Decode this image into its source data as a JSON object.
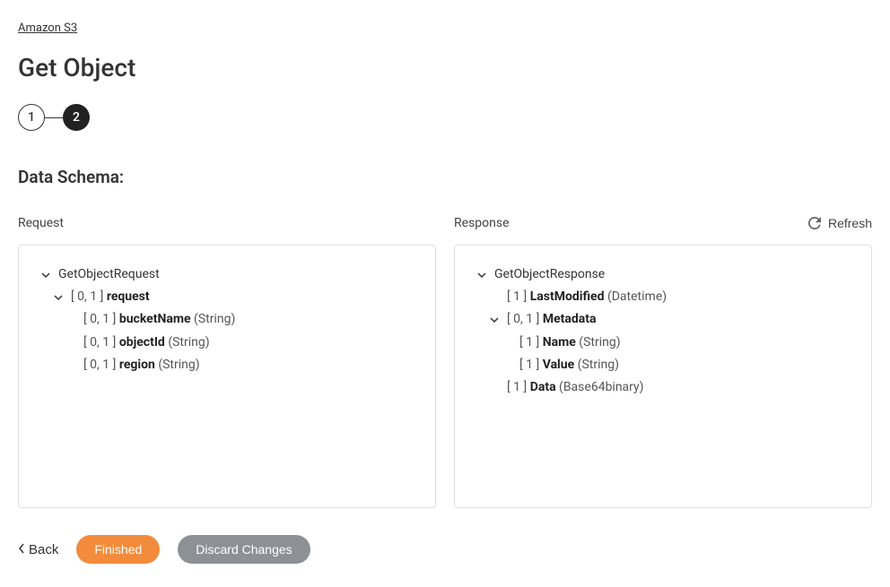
{
  "breadcrumb": {
    "parent": "Amazon S3"
  },
  "page": {
    "title": "Get Object",
    "section_title": "Data Schema:"
  },
  "stepper": {
    "step1": "1",
    "step2": "2"
  },
  "refresh_label": "Refresh",
  "columns": {
    "request": {
      "label": "Request",
      "root": "GetObjectRequest",
      "nodes": {
        "request_cardinality": "[ 0, 1 ]",
        "request_name": "request",
        "bucketName_cardinality": "[ 0, 1 ]",
        "bucketName_name": "bucketName",
        "bucketName_type": "(String)",
        "objectId_cardinality": "[ 0, 1 ]",
        "objectId_name": "objectId",
        "objectId_type": "(String)",
        "region_cardinality": "[ 0, 1 ]",
        "region_name": "region",
        "region_type": "(String)"
      }
    },
    "response": {
      "label": "Response",
      "root": "GetObjectResponse",
      "nodes": {
        "lastModified_cardinality": "[ 1 ]",
        "lastModified_name": "LastModified",
        "lastModified_type": "(Datetime)",
        "metadata_cardinality": "[ 0, 1 ]",
        "metadata_name": "Metadata",
        "mdName_cardinality": "[ 1 ]",
        "mdName_name": "Name",
        "mdName_type": "(String)",
        "mdValue_cardinality": "[ 1 ]",
        "mdValue_name": "Value",
        "mdValue_type": "(String)",
        "data_cardinality": "[ 1 ]",
        "data_name": "Data",
        "data_type": "(Base64binary)"
      }
    }
  },
  "actions": {
    "back": "Back",
    "finished": "Finished",
    "discard": "Discard Changes"
  }
}
